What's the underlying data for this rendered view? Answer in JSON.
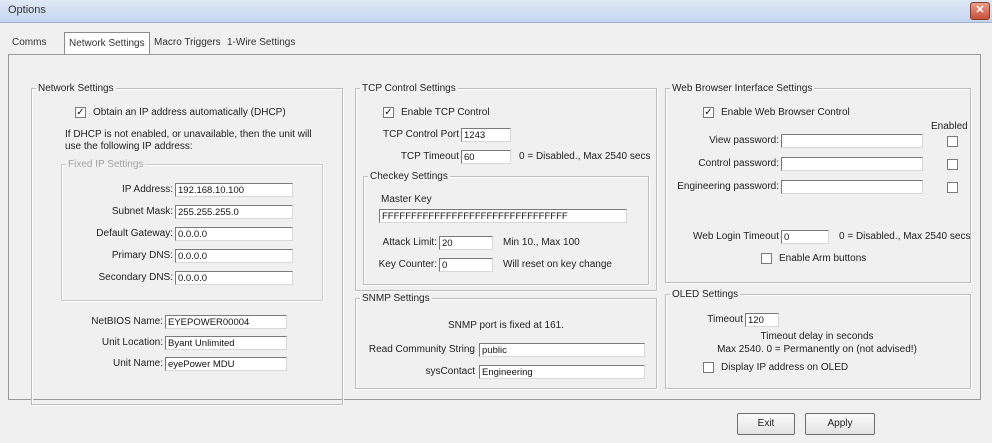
{
  "window": {
    "title": "Options",
    "close_glyph": "✕"
  },
  "tabs": [
    "Comms",
    "Network Settings",
    "Macro Triggers",
    "1-Wire Settings"
  ],
  "network": {
    "legend": "Network Settings",
    "dhcp_label": "Obtain an IP address automatically (DHCP)",
    "dhcp_checked": true,
    "dhcp_note": "If DHCP is not enabled, or unavailable, then the unit will use the following IP address:",
    "fixed_legend": "Fixed IP Settings",
    "ip_label": "IP Address:",
    "ip_value": "192.168.10.100",
    "mask_label": "Subnet Mask:",
    "mask_value": "255.255.255.0",
    "gateway_label": "Default Gateway:",
    "gateway_value": "0.0.0.0",
    "dns1_label": "Primary DNS:",
    "dns1_value": "0.0.0.0",
    "dns2_label": "Secondary DNS:",
    "dns2_value": "0.0.0.0",
    "netbios_label": "NetBIOS Name:",
    "netbios_value": "EYEPOWER00004",
    "location_label": "Unit Location:",
    "location_value": "Byant Unlimited",
    "name_label": "Unit Name:",
    "name_value": "eyePower MDU"
  },
  "tcp": {
    "legend": "TCP Control Settings",
    "enable_label": "Enable TCP Control",
    "enable_checked": true,
    "port_label": "TCP Control Port",
    "port_value": "1243",
    "timeout_label": "TCP Timeout",
    "timeout_value": "60",
    "timeout_note": "0 = Disabled., Max 2540 secs",
    "checkey_legend": "Checkey Settings",
    "master_label": "Master Key",
    "master_value": "FFFFFFFFFFFFFFFFFFFFFFFFFFFFFFFF",
    "attack_label": "Attack Limit:",
    "attack_value": "20",
    "attack_note": "Min 10., Max 100",
    "counter_label": "Key Counter:",
    "counter_value": "0",
    "counter_note": "Will reset on key change"
  },
  "snmp": {
    "legend": "SNMP Settings",
    "note": "SNMP port is fixed at 161.",
    "community_label": "Read Community String",
    "community_value": "public",
    "contact_label": "sysContact",
    "contact_value": "Engineering"
  },
  "web": {
    "legend": "Web Browser Interface Settings",
    "enable_label": "Enable Web Browser Control",
    "enable_checked": true,
    "enabled_header": "Enabled",
    "view_label": "View password:",
    "control_label": "Control password:",
    "engineering_label": "Engineering password:",
    "login_label": "Web Login Timeout",
    "login_value": "0",
    "login_note": "0 = Disabled., Max 2540 secs",
    "arm_label": "Enable Arm buttons"
  },
  "oled": {
    "legend": "OLED Settings",
    "timeout_label": "Timeout",
    "timeout_value": "120",
    "note1": "Timeout delay in seconds",
    "note2": "Max 2540. 0 = Permanently on (not advised!)",
    "display_ip_label": "Display IP address on OLED"
  },
  "buttons": {
    "exit": "Exit",
    "apply": "Apply"
  }
}
